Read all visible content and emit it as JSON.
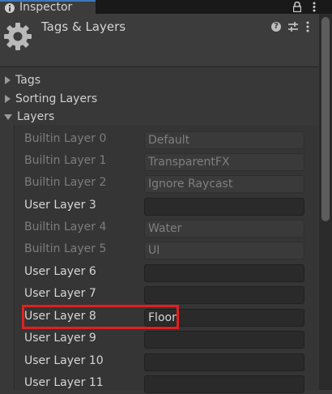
{
  "window": {
    "tab_label": "Inspector",
    "icons": [
      "info-icon",
      "lock-icon",
      "kebab-menu-icon"
    ]
  },
  "header": {
    "title": "Tags & Layers",
    "icons": [
      "gear-icon",
      "help-icon",
      "preset-icon",
      "kebab-menu-icon"
    ]
  },
  "foldouts": [
    {
      "label": "Tags",
      "expanded": false
    },
    {
      "label": "Sorting Layers",
      "expanded": false
    },
    {
      "label": "Layers",
      "expanded": true
    }
  ],
  "layers": [
    {
      "label": "Builtin Layer 0",
      "value": "Default",
      "editable": false
    },
    {
      "label": "Builtin Layer 1",
      "value": "TransparentFX",
      "editable": false
    },
    {
      "label": "Builtin Layer 2",
      "value": "Ignore Raycast",
      "editable": false
    },
    {
      "label": "User Layer 3",
      "value": "",
      "editable": true
    },
    {
      "label": "Builtin Layer 4",
      "value": "Water",
      "editable": false
    },
    {
      "label": "Builtin Layer 5",
      "value": "UI",
      "editable": false
    },
    {
      "label": "User Layer 6",
      "value": "",
      "editable": true
    },
    {
      "label": "User Layer 7",
      "value": "",
      "editable": true
    },
    {
      "label": "User Layer 8",
      "value": "Floor",
      "editable": true
    },
    {
      "label": "User Layer 9",
      "value": "",
      "editable": true
    },
    {
      "label": "User Layer 10",
      "value": "",
      "editable": true
    },
    {
      "label": "User Layer 11",
      "value": "",
      "editable": true
    }
  ],
  "colors": {
    "background": "#383838",
    "highlight_box": "#e02020",
    "tab_accent": "#3a79bb"
  }
}
